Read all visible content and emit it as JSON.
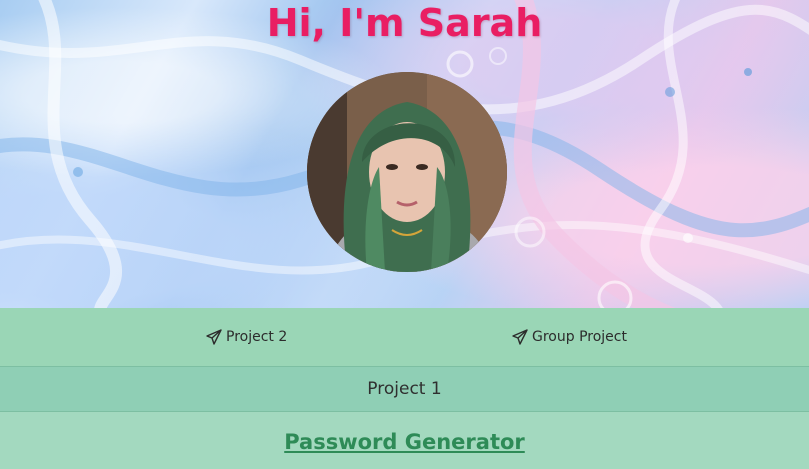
{
  "hero": {
    "title": "Hi, I'm Sarah",
    "avatar_alt": "Profile photo of Sarah"
  },
  "nav": {
    "items": [
      {
        "label": "Project 2",
        "icon": "paper-plane-icon"
      },
      {
        "label": "Group Project",
        "icon": "paper-plane-icon"
      }
    ]
  },
  "section": {
    "title": "Project 1"
  },
  "project": {
    "link_label": "Password Generator"
  },
  "colors": {
    "title": "#e91e63",
    "navbar": "#9ad6b6",
    "section_header": "#8fcfb5",
    "content_bg": "#a3d9bf",
    "link": "#2e8b57"
  }
}
